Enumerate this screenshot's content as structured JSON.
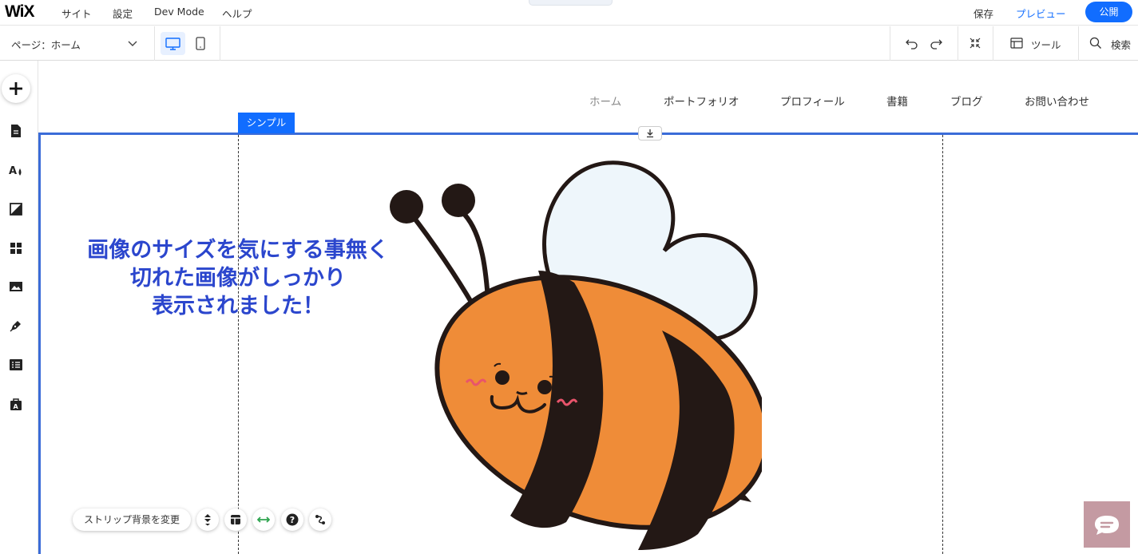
{
  "topbar": {
    "logo": "WiX",
    "menu": [
      "サイト",
      "設定",
      "Dev Mode",
      "ヘルプ"
    ],
    "save": "保存",
    "preview": "プレビュー",
    "publish": "公開"
  },
  "toolbar": {
    "page_selector": "ページ：ホーム",
    "tools_label": "ツール",
    "search_label": "検索"
  },
  "site_nav": [
    "ホーム",
    "ポートフォリオ",
    "プロフィール",
    "書籍",
    "ブログ",
    "お問い合わせ"
  ],
  "section_tag": "シンプル",
  "headline": [
    "画像のサイズを気にする事無く",
    "切れた画像がしっかり",
    "表示されました！"
  ],
  "bottom_tools": {
    "strip_bg": "ストリップ背景を変更"
  },
  "colors": {
    "accent": "#116dff",
    "section_border": "#3b6cd8",
    "headline": "#2b46cd",
    "bee_orange": "#ef8c38",
    "bee_dark": "#231815",
    "wing": "#eef6fb",
    "chat_bg": "#c49aa2"
  }
}
